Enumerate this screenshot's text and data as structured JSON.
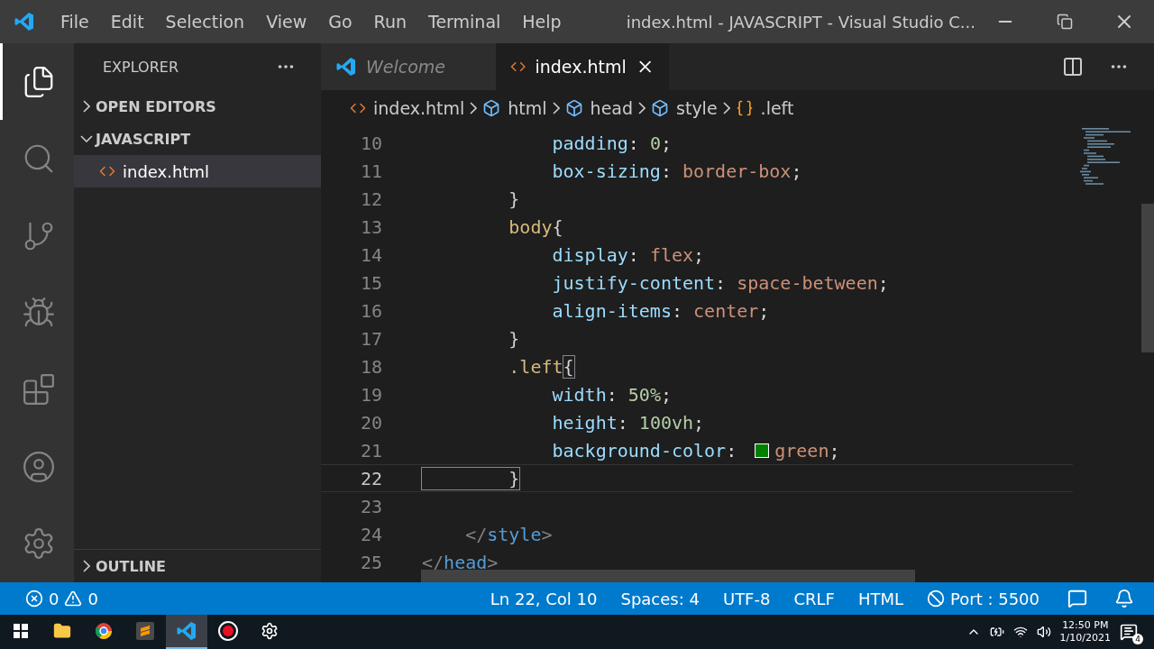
{
  "window": {
    "title": "index.html - JAVASCRIPT - Visual Studio C..."
  },
  "menu": [
    "File",
    "Edit",
    "Selection",
    "View",
    "Go",
    "Run",
    "Terminal",
    "Help"
  ],
  "activity_bar": [
    {
      "kind": "files",
      "selected": true
    },
    {
      "kind": "search",
      "selected": false
    },
    {
      "kind": "source-control",
      "selected": false
    },
    {
      "kind": "run",
      "selected": false
    },
    {
      "kind": "extensions",
      "selected": false
    },
    {
      "kind": "account",
      "selected": false
    },
    {
      "kind": "settings",
      "selected": false
    }
  ],
  "sidebar": {
    "title": "EXPLORER",
    "sections": [
      {
        "label": "OPEN EDITORS",
        "expanded": false
      },
      {
        "label": "JAVASCRIPT",
        "expanded": true,
        "items": [
          {
            "label": "index.html",
            "selected": true
          }
        ]
      }
    ],
    "footer_section": {
      "label": "OUTLINE",
      "expanded": false
    }
  },
  "tabs": [
    {
      "label": "Welcome",
      "kind": "welcome",
      "selected": false
    },
    {
      "label": "index.html",
      "kind": "html",
      "selected": true
    }
  ],
  "breadcrumbs": [
    {
      "label": "index.html",
      "kind": "file"
    },
    {
      "label": "html",
      "kind": "element"
    },
    {
      "label": "head",
      "kind": "element"
    },
    {
      "label": "style",
      "kind": "element"
    },
    {
      "label": ".left",
      "kind": "selector"
    }
  ],
  "editor": {
    "lines": [
      {
        "number": "10",
        "current": false,
        "tokens": [
          {
            "kind": "prop",
            "text": "            padding"
          },
          {
            "kind": "punct",
            "text": ": "
          },
          {
            "kind": "num",
            "text": "0"
          },
          {
            "kind": "punct",
            "text": ";"
          }
        ]
      },
      {
        "number": "11",
        "current": false,
        "tokens": [
          {
            "kind": "prop",
            "text": "            box-sizing"
          },
          {
            "kind": "punct",
            "text": ": "
          },
          {
            "kind": "value",
            "text": "border-box"
          },
          {
            "kind": "punct",
            "text": ";"
          }
        ]
      },
      {
        "number": "12",
        "current": false,
        "tokens": [
          {
            "kind": "punct",
            "text": "        }"
          }
        ]
      },
      {
        "number": "13",
        "current": false,
        "tokens": [
          {
            "kind": "selector",
            "text": "        body"
          },
          {
            "kind": "punct",
            "text": "{"
          }
        ]
      },
      {
        "number": "14",
        "current": false,
        "tokens": [
          {
            "kind": "prop",
            "text": "            display"
          },
          {
            "kind": "punct",
            "text": ": "
          },
          {
            "kind": "value",
            "text": "flex"
          },
          {
            "kind": "punct",
            "text": ";"
          }
        ]
      },
      {
        "number": "15",
        "current": false,
        "tokens": [
          {
            "kind": "prop",
            "text": "            justify-content"
          },
          {
            "kind": "punct",
            "text": ": "
          },
          {
            "kind": "value",
            "text": "space-between"
          },
          {
            "kind": "punct",
            "text": ";"
          }
        ]
      },
      {
        "number": "16",
        "current": false,
        "tokens": [
          {
            "kind": "prop",
            "text": "            align-items"
          },
          {
            "kind": "punct",
            "text": ": "
          },
          {
            "kind": "value",
            "text": "center"
          },
          {
            "kind": "punct",
            "text": ";"
          }
        ]
      },
      {
        "number": "17",
        "current": false,
        "tokens": [
          {
            "kind": "punct",
            "text": "        }"
          }
        ]
      },
      {
        "number": "18",
        "current": false,
        "tokens": [
          {
            "kind": "selector",
            "text": "        .left"
          },
          {
            "kind": "bracket",
            "text": "{"
          }
        ]
      },
      {
        "number": "19",
        "current": false,
        "tokens": [
          {
            "kind": "prop",
            "text": "            width"
          },
          {
            "kind": "punct",
            "text": ": "
          },
          {
            "kind": "num",
            "text": "50%"
          },
          {
            "kind": "punct",
            "text": ";"
          }
        ]
      },
      {
        "number": "20",
        "current": false,
        "tokens": [
          {
            "kind": "prop",
            "text": "            height"
          },
          {
            "kind": "punct",
            "text": ": "
          },
          {
            "kind": "num",
            "text": "100vh"
          },
          {
            "kind": "punct",
            "text": ";"
          }
        ]
      },
      {
        "number": "21",
        "current": false,
        "tokens": [
          {
            "kind": "prop",
            "text": "            background-color"
          },
          {
            "kind": "punct",
            "text": ": "
          },
          {
            "kind": "swatch",
            "color": "#008000"
          },
          {
            "kind": "value",
            "text": "green"
          },
          {
            "kind": "punct",
            "text": ";"
          }
        ]
      },
      {
        "number": "22",
        "current": true,
        "tokens": [
          {
            "kind": "bracket",
            "text": "        }"
          }
        ]
      },
      {
        "number": "23",
        "current": false
      },
      {
        "number": "24",
        "current": false,
        "tokens": [
          {
            "kind": "angle",
            "text": "    </"
          },
          {
            "kind": "tag",
            "text": "style"
          },
          {
            "kind": "angle",
            "text": ">"
          }
        ]
      },
      {
        "number": "25",
        "current": false,
        "tokens": [
          {
            "kind": "angle",
            "text": "</"
          },
          {
            "kind": "tag",
            "text": "head"
          },
          {
            "kind": "angle",
            "text": ">"
          }
        ]
      }
    ]
  },
  "status_bar": {
    "errors": "0",
    "warnings": "0",
    "items": [
      {
        "kind": "text",
        "label": "Ln 22, Col 10"
      },
      {
        "kind": "text",
        "label": "Spaces: 4"
      },
      {
        "kind": "text",
        "label": "UTF-8"
      },
      {
        "kind": "text",
        "label": "CRLF"
      },
      {
        "kind": "text",
        "label": "HTML"
      },
      {
        "kind": "port",
        "label": "Port : 5500"
      },
      {
        "kind": "feedback"
      },
      {
        "kind": "bell"
      }
    ]
  },
  "taskbar": {
    "apps": [
      {
        "kind": "start",
        "selected": false
      },
      {
        "kind": "folder",
        "selected": false
      },
      {
        "kind": "browser",
        "selected": false
      },
      {
        "kind": "sublime",
        "selected": false
      },
      {
        "kind": "vscode",
        "selected": true
      },
      {
        "kind": "record",
        "selected": false
      },
      {
        "kind": "gear",
        "selected": false
      }
    ],
    "time": "12:50 PM",
    "date": "1/10/2021",
    "notifications": "4"
  }
}
